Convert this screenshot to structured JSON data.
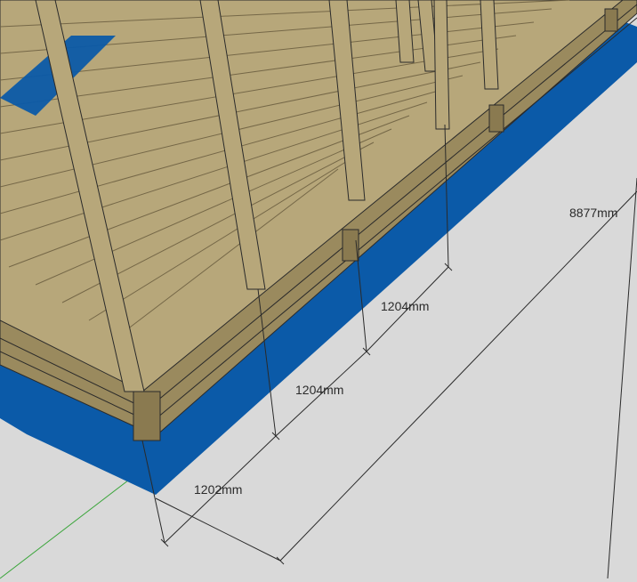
{
  "app": {
    "colors": {
      "ground": "#d9d9d9",
      "blue_membrane": "#0b5aa8",
      "deck_light": "#b7a77a",
      "deck_mid": "#9a8a5e",
      "deck_dark": "#6e6142",
      "edge_line": "#2a2a2a",
      "axis_green": "#3aa53a"
    }
  },
  "dimensions": {
    "d1": "8877mm",
    "d2": "1204mm",
    "d3": "1204mm",
    "d4": "1202mm"
  }
}
